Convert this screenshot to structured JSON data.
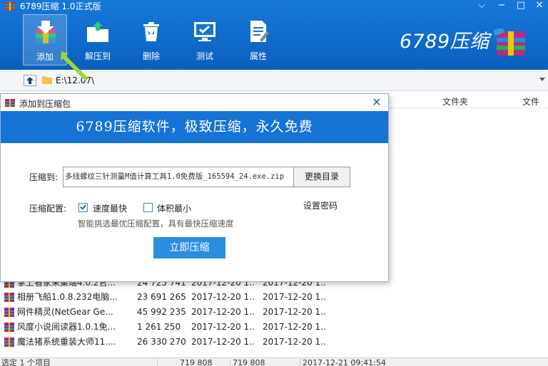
{
  "window": {
    "title": "6789压缩 1.0正式版",
    "controls": {
      "skin": "⌵",
      "minimize": "−",
      "maximize": "□",
      "close": "✕"
    }
  },
  "toolbar": {
    "items": [
      {
        "label": "添加",
        "icon": "add-archive-icon",
        "active": true
      },
      {
        "label": "解压到",
        "icon": "extract-icon",
        "active": false
      },
      {
        "label": "删除",
        "icon": "trash-icon",
        "active": false
      },
      {
        "label": "测试",
        "icon": "test-monitor-icon",
        "active": false
      },
      {
        "label": "属性",
        "icon": "properties-icon",
        "active": false
      }
    ],
    "brand": "6789压缩"
  },
  "address": {
    "path": "E:\\12.07\\"
  },
  "file_list": {
    "headers": [
      "文件夹",
      "文件"
    ],
    "rows": [
      {
        "name": "掌上看家采集端4.0.2官...",
        "size": "24 725 741",
        "modified": "2017-12-20 1...",
        "created": "2017-12-20 1..."
      },
      {
        "name": "相册飞船1.0.8.232电脑...",
        "size": "23 691 265",
        "modified": "2017-12-20 1...",
        "created": "2017-12-20 1..."
      },
      {
        "name": "网件精灵(NetGear Ge...",
        "size": "45 992 235",
        "modified": "2017-12-20 1...",
        "created": "2017-12-20 1..."
      },
      {
        "name": "风度小说阅读器1.0.1免...",
        "size": "1 261 250",
        "modified": "2017-12-20 1...",
        "created": "2017-12-20 1..."
      },
      {
        "name": "魔法猪系统重装大师11....",
        "size": "26 330 270",
        "modified": "2017-12-20 1...",
        "created": "2017-12-20 1..."
      }
    ]
  },
  "status": {
    "selected": "选定 1 个项目",
    "size1": "719 808",
    "size2": "719 808",
    "time": "2017-12-21 09:41:54"
  },
  "dialog": {
    "title": "添加到压缩包",
    "close": "✕",
    "banner": "6789压缩软件，极致压缩，永久免费",
    "target_label": "压缩到:",
    "target_value": "多线螺纹三针测量M值计算工具1.0免费版_165594_24.exe.zip",
    "change_dir": "更换目录",
    "config_label": "压缩配置:",
    "options": [
      {
        "label": "速度最快",
        "checked": true
      },
      {
        "label": "体积最小",
        "checked": false
      }
    ],
    "set_password": "设置密码",
    "hint": "智能挑选最优压缩配置，具有最快压缩速度",
    "compress_button": "立即压缩"
  },
  "colors": {
    "accent": "#1573d5",
    "button": "#2a8de0",
    "highlight_arrow": "#9ed63a"
  }
}
